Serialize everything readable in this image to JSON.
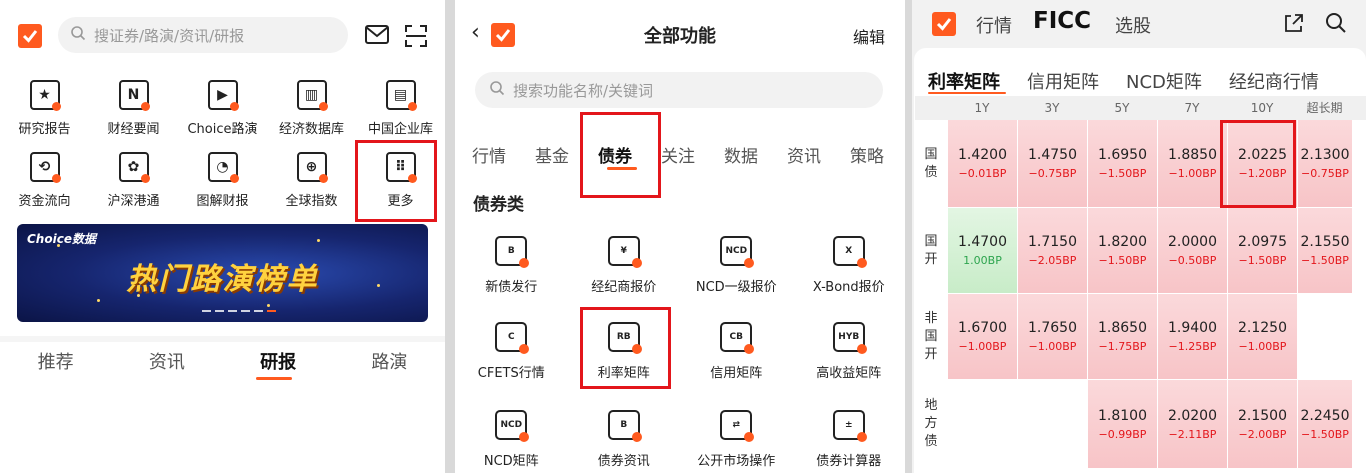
{
  "colors": {
    "brand": "#ff5a1f",
    "highlight": "#e3161b",
    "down": "#e3161b",
    "up": "#2da44e"
  },
  "panel1": {
    "search_placeholder": "搜证券/路演/资讯/研报",
    "row1": [
      {
        "label": "研究报告",
        "icon": "research-report-icon",
        "glyph": "★"
      },
      {
        "label": "财经要闻",
        "icon": "finance-news-icon",
        "glyph": "N"
      },
      {
        "label": "Choice路演",
        "icon": "roadshow-play-icon",
        "glyph": "▶"
      },
      {
        "label": "经济数据库",
        "icon": "economic-database-icon",
        "glyph": "▥"
      },
      {
        "label": "中国企业库",
        "icon": "company-library-icon",
        "glyph": "▤"
      }
    ],
    "row2": [
      {
        "label": "资金流向",
        "icon": "fund-flow-icon",
        "glyph": "⟲"
      },
      {
        "label": "沪深港通",
        "icon": "hk-connect-icon",
        "glyph": "✿"
      },
      {
        "label": "图解财报",
        "icon": "financial-chart-icon",
        "glyph": "◔"
      },
      {
        "label": "全球指数",
        "icon": "globe-icon",
        "glyph": "⊕"
      },
      {
        "label": "更多",
        "icon": "more-icon",
        "glyph": "⠿"
      }
    ],
    "banner_brand": "Choice数据",
    "banner_title": "热门路演榜单",
    "tabs": [
      "推荐",
      "资讯",
      "研报",
      "路演"
    ],
    "active_tab": "研报"
  },
  "panel2": {
    "title": "全部功能",
    "edit": "编辑",
    "search_placeholder": "搜索功能名称/关键词",
    "tabs": [
      "行情",
      "基金",
      "债券",
      "关注",
      "数据",
      "资讯",
      "策略"
    ],
    "active_tab": "债券",
    "section": "债券类",
    "row1": [
      {
        "label": "新债发行",
        "icon": "new-bond-icon",
        "glyph": "B"
      },
      {
        "label": "经纪商报价",
        "icon": "broker-quote-icon",
        "glyph": "¥"
      },
      {
        "label": "NCD一级报价",
        "icon": "ncd-quote-icon",
        "glyph": "NCD"
      },
      {
        "label": "X-Bond报价",
        "icon": "xbond-quote-icon",
        "glyph": "X"
      }
    ],
    "row2": [
      {
        "label": "CFETS行情",
        "icon": "cfets-icon",
        "glyph": "C"
      },
      {
        "label": "利率矩阵",
        "icon": "rate-matrix-icon",
        "glyph": "RB"
      },
      {
        "label": "信用矩阵",
        "icon": "credit-matrix-icon",
        "glyph": "CB"
      },
      {
        "label": "高收益矩阵",
        "icon": "high-yield-matrix-icon",
        "glyph": "HYB"
      }
    ],
    "row3": [
      {
        "label": "NCD矩阵",
        "icon": "ncd-matrix-icon",
        "glyph": "NCD"
      },
      {
        "label": "债券资讯",
        "icon": "bond-news-icon",
        "glyph": "B"
      },
      {
        "label": "公开市场操作",
        "icon": "open-market-icon",
        "glyph": "⇄"
      },
      {
        "label": "债券计算器",
        "icon": "bond-calculator-icon",
        "glyph": "±"
      }
    ]
  },
  "panel3": {
    "nav": [
      "行情",
      "FICC",
      "选股"
    ],
    "tabs": [
      "利率矩阵",
      "信用矩阵",
      "NCD矩阵",
      "经纪商行情"
    ],
    "active_tab": "利率矩阵",
    "columns": [
      "1Y",
      "3Y",
      "5Y",
      "7Y",
      "10Y",
      "超长期"
    ],
    "rows": [
      {
        "label": [
          "国",
          "债"
        ],
        "cells": [
          {
            "v": "1.4200",
            "d": "−0.01BP",
            "t": "red"
          },
          {
            "v": "1.4750",
            "d": "−0.75BP",
            "t": "red"
          },
          {
            "v": "1.6950",
            "d": "−1.50BP",
            "t": "red"
          },
          {
            "v": "1.8850",
            "d": "−1.00BP",
            "t": "red"
          },
          {
            "v": "2.0225",
            "d": "−1.20BP",
            "t": "red"
          },
          {
            "v": "2.1300",
            "d": "−0.75BP",
            "t": "red"
          }
        ]
      },
      {
        "label": [
          "国",
          "开"
        ],
        "cells": [
          {
            "v": "1.4700",
            "d": "1.00BP",
            "t": "green"
          },
          {
            "v": "1.7150",
            "d": "−2.05BP",
            "t": "red"
          },
          {
            "v": "1.8200",
            "d": "−1.50BP",
            "t": "red"
          },
          {
            "v": "2.0000",
            "d": "−0.50BP",
            "t": "red"
          },
          {
            "v": "2.0975",
            "d": "−1.50BP",
            "t": "red"
          },
          {
            "v": "2.1550",
            "d": "−1.50BP",
            "t": "red"
          }
        ]
      },
      {
        "label": [
          "非",
          "国",
          "开"
        ],
        "cells": [
          {
            "v": "1.6700",
            "d": "−1.00BP",
            "t": "red"
          },
          {
            "v": "1.7650",
            "d": "−1.00BP",
            "t": "red"
          },
          {
            "v": "1.8650",
            "d": "−1.75BP",
            "t": "red"
          },
          {
            "v": "1.9400",
            "d": "−1.25BP",
            "t": "red"
          },
          {
            "v": "2.1250",
            "d": "−1.00BP",
            "t": "red"
          },
          {
            "v": "",
            "d": "",
            "t": "empty"
          }
        ]
      },
      {
        "label": [
          "地",
          "方",
          "债"
        ],
        "cells": [
          {
            "v": "",
            "d": "",
            "t": "empty"
          },
          {
            "v": "",
            "d": "",
            "t": "empty"
          },
          {
            "v": "1.8100",
            "d": "−0.99BP",
            "t": "red"
          },
          {
            "v": "2.0200",
            "d": "−2.11BP",
            "t": "red"
          },
          {
            "v": "2.1500",
            "d": "−2.00BP",
            "t": "red"
          },
          {
            "v": "2.2450",
            "d": "−1.50BP",
            "t": "red"
          }
        ]
      }
    ]
  }
}
